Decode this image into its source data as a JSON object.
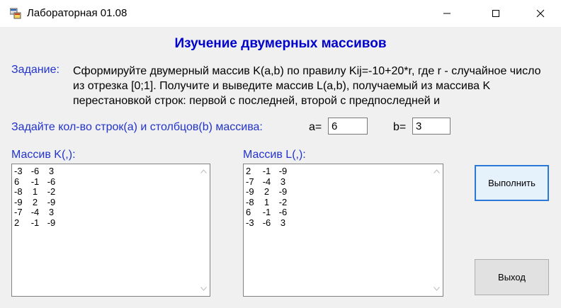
{
  "window": {
    "title": "Лабораторная 01.08"
  },
  "heading": "Изучение двумерных массивов",
  "task": {
    "label": "Задание:",
    "text": "Сформируйте двумерный массив K(a,b) по правилу Kij=-10+20*r, где r - случайное число из отрезка [0;1]. Получите и выведите массив L(a,b), получаемый из массива K перестановкой строк: первой с последней, второй с предпоследней и"
  },
  "size": {
    "label": "Задайте кол-во строк(a) и столбцов(b) массива:",
    "a_label": "a=",
    "a_value": "6",
    "b_label": "b=",
    "b_value": "3"
  },
  "array_k": {
    "label": "Массив K(,):",
    "rows": [
      [
        "-3",
        "-6",
        "3"
      ],
      [
        "6",
        "-1",
        "-6"
      ],
      [
        "-8",
        "1",
        "-2"
      ],
      [
        "-9",
        "2",
        "-9"
      ],
      [
        "-7",
        "-4",
        "3"
      ],
      [
        "2",
        "-1",
        "-9"
      ]
    ]
  },
  "array_l": {
    "label": "Массив L(,):",
    "rows": [
      [
        "2",
        "-1",
        "-9"
      ],
      [
        "-7",
        "-4",
        "3"
      ],
      [
        "-9",
        "2",
        "-9"
      ],
      [
        "-8",
        "1",
        "-2"
      ],
      [
        "6",
        "-1",
        "-6"
      ],
      [
        "-3",
        "-6",
        "3"
      ]
    ]
  },
  "buttons": {
    "run": "Выполнить",
    "exit": "Выход"
  },
  "colors": {
    "label_blue": "#2233cc",
    "heading_blue": "#0000cc",
    "focus": "#2b78d6"
  }
}
